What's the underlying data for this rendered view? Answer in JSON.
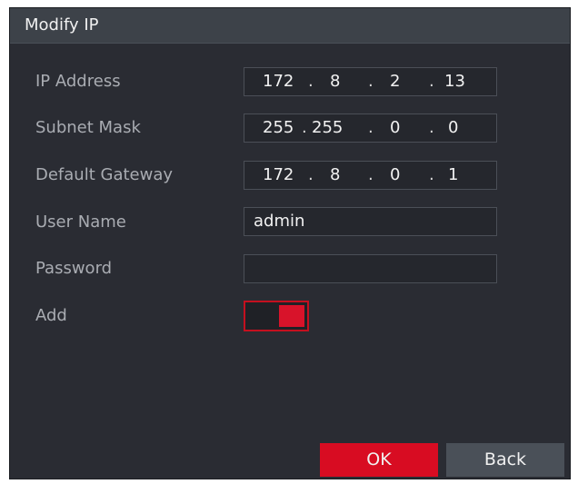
{
  "dialog": {
    "title": "Modify IP"
  },
  "fields": {
    "ip_address": {
      "label": "IP Address",
      "octets": [
        "172",
        "8",
        "2",
        "13"
      ]
    },
    "subnet_mask": {
      "label": "Subnet Mask",
      "octets": [
        "255",
        "255",
        "0",
        "0"
      ]
    },
    "default_gateway": {
      "label": "Default Gateway",
      "octets": [
        "172",
        "8",
        "0",
        "1"
      ]
    },
    "user_name": {
      "label": "User Name",
      "value": "admin"
    },
    "password": {
      "label": "Password",
      "value": ""
    },
    "add": {
      "label": "Add",
      "enabled": true
    }
  },
  "ip_separator": ".",
  "buttons": {
    "ok": "OK",
    "back": "Back"
  },
  "colors": {
    "accent": "#d80c22",
    "background": "#2a2c33",
    "titlebar": "#3d4249"
  }
}
